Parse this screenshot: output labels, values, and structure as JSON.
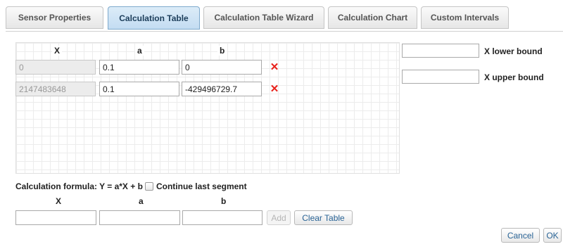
{
  "tabs": [
    {
      "label": "Sensor Properties",
      "active": false
    },
    {
      "label": "Calculation Table",
      "active": true
    },
    {
      "label": "Calculation Table Wizard",
      "active": false
    },
    {
      "label": "Calculation Chart",
      "active": false
    },
    {
      "label": "Custom Intervals",
      "active": false
    }
  ],
  "table": {
    "headers": {
      "x": "X",
      "a": "a",
      "b": "b"
    },
    "rows": [
      {
        "x": "0",
        "a": "0.1",
        "b": "0"
      },
      {
        "x": "2147483648",
        "a": "0.1",
        "b": "-429496729.7"
      }
    ],
    "delete_glyph": "✕"
  },
  "bounds": {
    "lower_label": "X lower bound",
    "lower_value": "",
    "upper_label": "X upper bound",
    "upper_value": ""
  },
  "formula": {
    "text": "Calculation formula: Y = a*X + b",
    "continue_label": "Continue last segment",
    "continue_checked": false
  },
  "new_row": {
    "headers": {
      "x": "X",
      "a": "a",
      "b": "b"
    },
    "x": "",
    "a": "",
    "b": "",
    "add_label": "Add",
    "clear_label": "Clear Table"
  },
  "footer": {
    "cancel_label": "Cancel",
    "ok_label": "OK"
  },
  "colors": {
    "active_tab": "#c3dcf2",
    "delete_icon": "#e8201a",
    "link_button_text": "#2a6496"
  },
  "icons": {
    "delete": "delete-x-icon",
    "checkbox": "checkbox-icon"
  }
}
